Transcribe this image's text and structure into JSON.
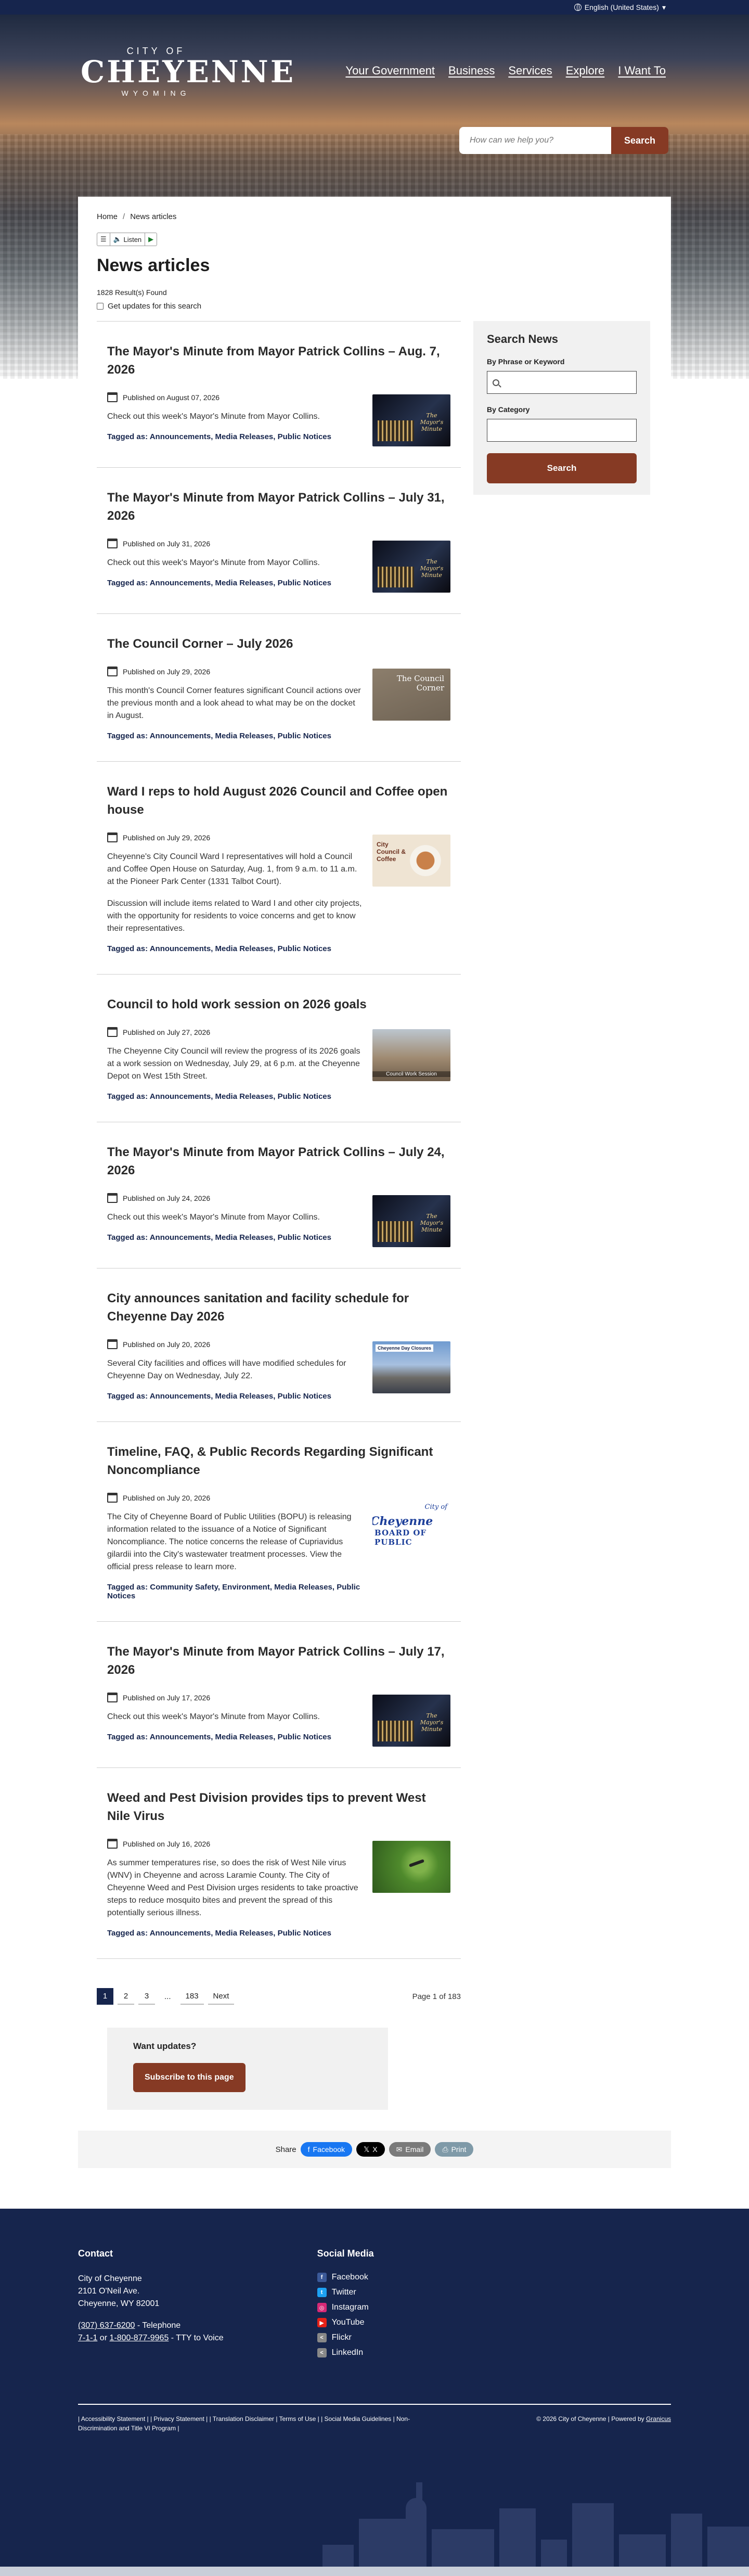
{
  "topbar": {
    "language": "English (United States)"
  },
  "brand": {
    "city_of": "CITY OF",
    "name": "CHEYENNE",
    "state": "WYOMING"
  },
  "nav": [
    "Your Government",
    "Business",
    "Services",
    "Explore",
    "I Want To"
  ],
  "search": {
    "placeholder": "How can we help you?",
    "button": "Search"
  },
  "breadcrumb": {
    "home": "Home",
    "current": "News articles"
  },
  "listen": {
    "label": "Listen"
  },
  "page": {
    "title": "News articles",
    "count": "1828 Result(s) Found",
    "updates": "Get updates for this search"
  },
  "articles": [
    {
      "title": "The Mayor's Minute from Mayor Patrick Collins – Aug. 7, 2026",
      "date": "Published on August 07, 2026",
      "summary": "Check out this week's Mayor's Minute from Mayor Collins.",
      "tags_label": "Tagged as:",
      "tags": "Announcements, Media Releases, Public Notices"
    },
    {
      "title": "The Mayor's Minute from Mayor Patrick Collins – July 31, 2026",
      "date": "Published on July 31, 2026",
      "summary": "Check out this week's Mayor's Minute from Mayor Collins.",
      "tags_label": "Tagged as:",
      "tags": "Announcements, Media Releases, Public Notices"
    },
    {
      "title": "The Council Corner – July 2026",
      "date": "Published on July 29, 2026",
      "summary": "This month's Council Corner features significant Council actions over the previous month and a look ahead to what may be on the docket in August.",
      "tags_label": "Tagged as:",
      "tags": "Announcements, Media Releases, Public Notices"
    },
    {
      "title": "Ward I reps to hold August 2026 Council and Coffee open house",
      "date": "Published on July 29, 2026",
      "summary": "Cheyenne's City Council Ward I representatives will hold a Council and Coffee Open House on Saturday, Aug. 1, from 9 a.m. to 11 a.m. at the Pioneer Park Center (1331 Talbot Court).",
      "summary2": "Discussion will include items related to Ward I and other city projects, with the opportunity for residents to voice concerns and get to know their representatives.",
      "tags_label": "Tagged as:",
      "tags": "Announcements, Media Releases, Public Notices"
    },
    {
      "title": "Council to hold work session on 2026 goals",
      "date": "Published on July 27, 2026",
      "summary": "The Cheyenne City Council will review the progress of its 2026 goals at a work session on Wednesday, July 29, at 6 p.m. at the Cheyenne Depot on West 15th Street.",
      "tags_label": "Tagged as:",
      "tags": "Announcements, Media Releases, Public Notices"
    },
    {
      "title": "The Mayor's Minute from Mayor Patrick Collins – July 24, 2026",
      "date": "Published on July 24, 2026",
      "summary": "Check out this week's Mayor's Minute from Mayor Collins.",
      "tags_label": "Tagged as:",
      "tags": "Announcements, Media Releases, Public Notices"
    },
    {
      "title": "City announces sanitation and facility schedule for Cheyenne Day 2026",
      "date": "Published on July 20, 2026",
      "summary": "Several City facilities and offices will have modified schedules for Cheyenne Day on Wednesday, July 22.",
      "tags_label": "Tagged as:",
      "tags": "Announcements, Media Releases, Public Notices"
    },
    {
      "title": "Timeline, FAQ, & Public Records Regarding Significant Noncompliance",
      "date": "Published on July 20, 2026",
      "summary": "The City of Cheyenne Board of Public Utilities (BOPU) is releasing information related to the issuance of a Notice of Significant Noncompliance. The notice concerns the release of Cupriavidus gilardii into the City's wastewater treatment processes. View the official press release to learn more.",
      "tags_label": "Tagged as:",
      "tags": "Community Safety, Environment, Media Releases, Public Notices"
    },
    {
      "title": "The Mayor's Minute from Mayor Patrick Collins – July 17, 2026",
      "date": "Published on July 17, 2026",
      "summary": "Check out this week's Mayor's Minute from Mayor Collins.",
      "tags_label": "Tagged as:",
      "tags": "Announcements, Media Releases, Public Notices"
    },
    {
      "title": "Weed and Pest Division provides tips to prevent West Nile Virus",
      "date": "Published on July 16, 2026",
      "summary": "As summer temperatures rise, so does the risk of West Nile virus (WNV) in Cheyenne and across Laramie County. The City of Cheyenne Weed and Pest Division urges residents to take proactive steps to reduce mosquito bites and prevent the spread of this potentially serious illness.",
      "tags_label": "Tagged as:",
      "tags": "Announcements, Media Releases, Public Notices"
    }
  ],
  "thumbs": {
    "council_corner": "The Council Corner",
    "council_coffee": "City Council & Coffee",
    "bopu_city": "City of",
    "bopu_name": "Cheyenne",
    "bopu_board": "BOARD OF PUBLIC"
  },
  "sidebar": {
    "title": "Search News",
    "phrase_label": "By Phrase or Keyword",
    "category_label": "By Category",
    "button": "Search"
  },
  "pagination": {
    "pages": [
      "1",
      "2",
      "3",
      "...",
      "183"
    ],
    "next": "Next",
    "status": "Page 1 of 183"
  },
  "want": {
    "title": "Want updates?",
    "button": "Subscribe to this page"
  },
  "share": {
    "label": "Share",
    "facebook": "Facebook",
    "x": "X",
    "email": "Email",
    "print": "Print"
  },
  "footer": {
    "contact_title": "Contact",
    "org": "City of Cheyenne",
    "street": "2101 O'Neil Ave.",
    "city": "Cheyenne, WY 82001",
    "phone": "(307) 637-6200",
    "phone_suffix": " - Telephone",
    "tty_a": "7-1-1",
    "tty_or": " or ",
    "tty_b": "1-800-877-9965",
    "tty_suffix": " - TTY to Voice",
    "social_title": "Social Media",
    "social": [
      "Facebook",
      "Twitter",
      "Instagram",
      "YouTube",
      "Flickr",
      "LinkedIn"
    ],
    "legal_links": "| Accessibility Statement | | Privacy Statement | | Translation Disclaimer | Terms of Use | | Social Media Guidelines | Non-Discrimination and Title VI Program |",
    "copyright": "© 2026 City of Cheyenne | Powered by ",
    "powered": "Granicus"
  },
  "colors": {
    "navy": "#16254d",
    "brick": "#863a24"
  }
}
